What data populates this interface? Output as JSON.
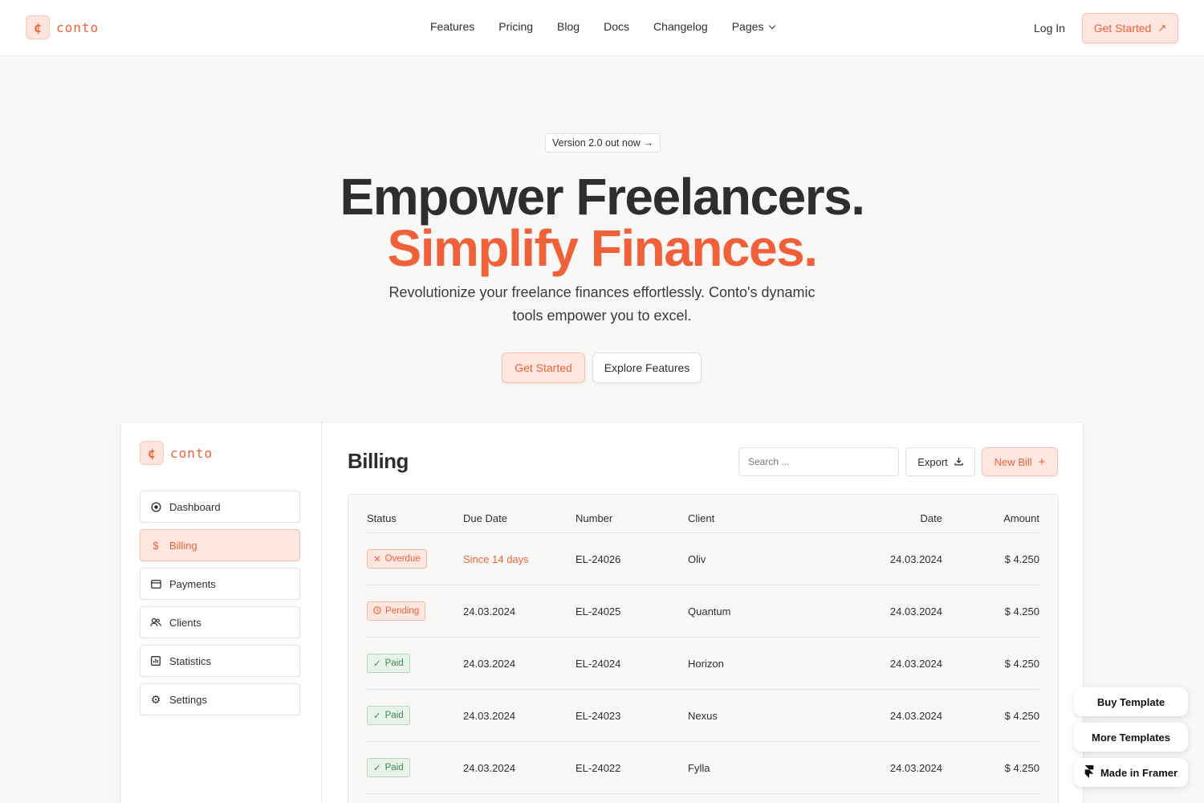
{
  "brand": {
    "mark": "¢",
    "name": "conto"
  },
  "nav": {
    "items": [
      "Features",
      "Pricing",
      "Blog",
      "Docs",
      "Changelog"
    ],
    "pages_label": "Pages",
    "login_label": "Log In",
    "cta_label": "Get Started"
  },
  "hero": {
    "pill": "Version 2.0 out now",
    "line1": "Empower Freelancers.",
    "line2": "Simplify Finances.",
    "subtitle": "Revolutionize your freelance finances effortlessly. Conto's dynamic tools empower you to excel.",
    "cta_primary": "Get Started",
    "cta_secondary": "Explore Features"
  },
  "app": {
    "brand_name": "conto",
    "sidebar": [
      {
        "label": "Dashboard",
        "icon": "dashboard-icon",
        "active": false
      },
      {
        "label": "Billing",
        "icon": "dollar-icon",
        "active": true
      },
      {
        "label": "Payments",
        "icon": "card-icon",
        "active": false
      },
      {
        "label": "Clients",
        "icon": "users-icon",
        "active": false
      },
      {
        "label": "Statistics",
        "icon": "chart-icon",
        "active": false
      },
      {
        "label": "Settings",
        "icon": "gear-icon",
        "active": false
      }
    ],
    "title": "Billing",
    "search_placeholder": "Search ...",
    "export_label": "Export",
    "new_bill_label": "New Bill",
    "table": {
      "headers": {
        "status": "Status",
        "due": "Due Date",
        "number": "Number",
        "client": "Client",
        "date": "Date",
        "amount": "Amount"
      },
      "rows": [
        {
          "status": "Overdue",
          "status_type": "overdue",
          "due": "Since 14 days",
          "number": "EL-24026",
          "client": "Oliv",
          "date": "24.03.2024",
          "amount": "$ 4.250"
        },
        {
          "status": "Pending",
          "status_type": "pending",
          "due": "24.03.2024",
          "number": "EL-24025",
          "client": "Quantum",
          "date": "24.03.2024",
          "amount": "$ 4.250"
        },
        {
          "status": "Paid",
          "status_type": "paid",
          "due": "24.03.2024",
          "number": "EL-24024",
          "client": "Horizon",
          "date": "24.03.2024",
          "amount": "$ 4.250"
        },
        {
          "status": "Paid",
          "status_type": "paid",
          "due": "24.03.2024",
          "number": "EL-24023",
          "client": "Nexus",
          "date": "24.03.2024",
          "amount": "$ 4.250"
        },
        {
          "status": "Paid",
          "status_type": "paid",
          "due": "24.03.2024",
          "number": "EL-24022",
          "client": "Fylla",
          "date": "24.03.2024",
          "amount": "$ 4.250"
        }
      ]
    }
  },
  "floating": {
    "buy": "Buy Template",
    "more": "More Templates",
    "framer": "Made in Framer"
  },
  "colors": {
    "accent": "#f0613a",
    "accent_bg": "#fde7e0",
    "paid": "#3f8a55",
    "page_bg": "#f9f8f6"
  }
}
